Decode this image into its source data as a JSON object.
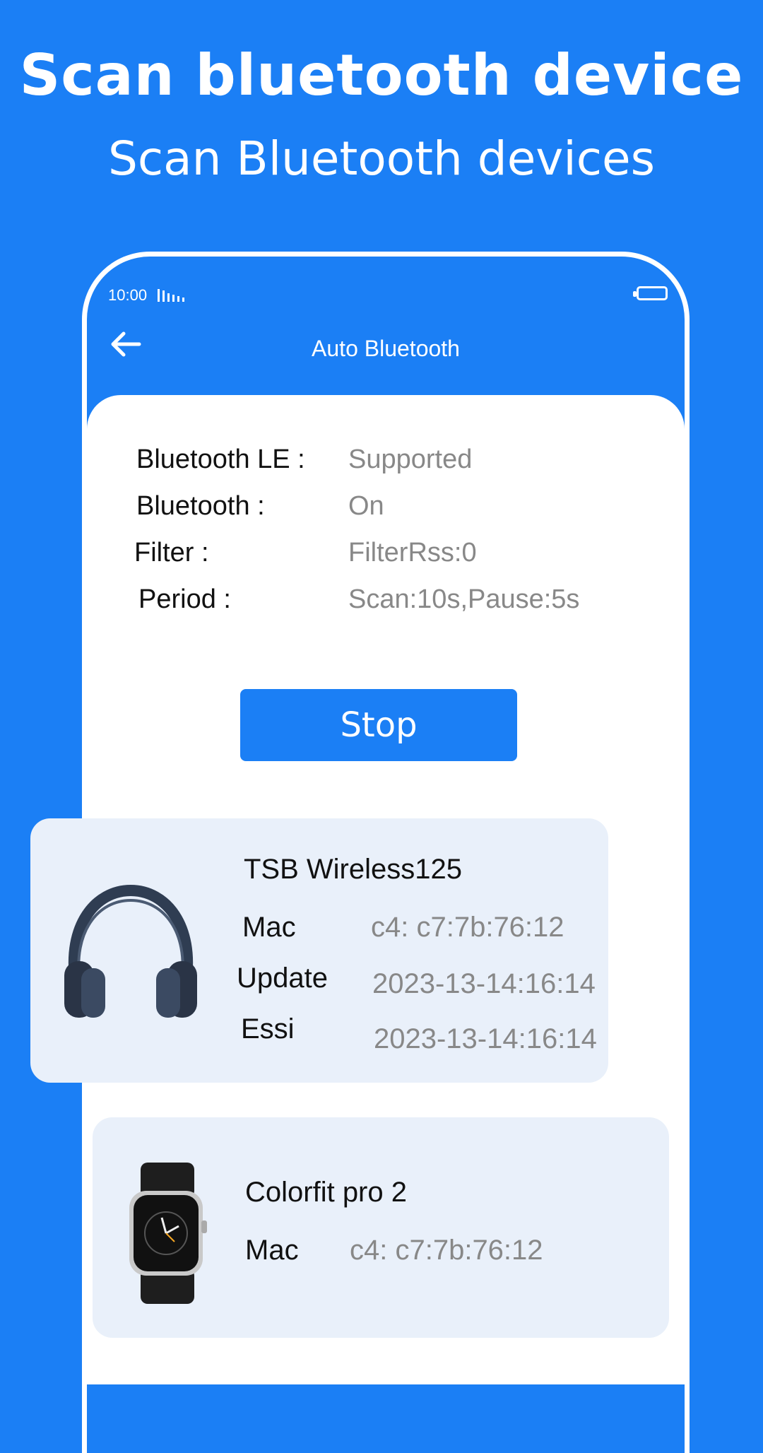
{
  "headline": {
    "title": "Scan bluetooth device",
    "subtitle": "Scan Bluetooth devices"
  },
  "status_bar": {
    "time": "10:00"
  },
  "app_bar": {
    "title": "Auto Bluetooth"
  },
  "info": [
    {
      "label": "Bluetooth LE :",
      "value": "Supported"
    },
    {
      "label": "Bluetooth :",
      "value": "On"
    },
    {
      "label": "Filter :",
      "value": "FilterRss:0"
    },
    {
      "label": "Period :",
      "value": "Scan:10s,Pause:5s"
    }
  ],
  "stop_button": "Stop",
  "devices": [
    {
      "name": "TSB Wireless125",
      "icon": "headphones-icon",
      "fields": [
        {
          "label": "Mac",
          "value": "c4: c7:7b:76:12"
        },
        {
          "label": "Update",
          "value": "2023-13-14:16:14"
        },
        {
          "label": "Essi",
          "value": "2023-13-14:16:14"
        }
      ]
    },
    {
      "name": "Colorfit pro 2",
      "icon": "smartwatch-icon",
      "fields": [
        {
          "label": "Mac",
          "value": "c4: c7:7b:76:12"
        }
      ]
    }
  ],
  "colors": {
    "primary": "#1b7ff5",
    "card_bg": "#e9f0fa",
    "value_gray": "#888888"
  }
}
